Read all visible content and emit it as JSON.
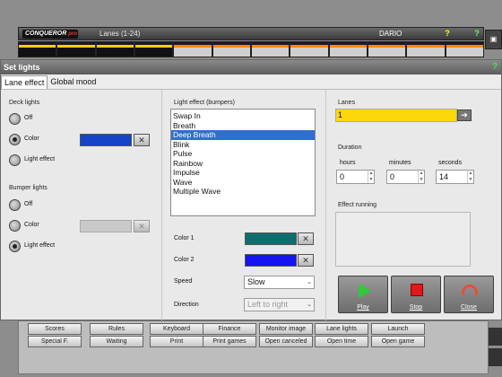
{
  "app": {
    "logo": "CONQUEROR",
    "logo_suffix": "pro",
    "lanes_label": "Lanes (1-24)",
    "user": "DARIO",
    "help_icon": "question-icon",
    "check_icon": "question-check-icon"
  },
  "background_buttons": {
    "row1": [
      "Scores",
      "Rules",
      "Keyboard",
      "Finance",
      "Monitor image",
      "Lane lights",
      "Launch"
    ],
    "row2": [
      "Special F.",
      "Waiting",
      "Print",
      "Print games",
      "Open canceled",
      "Open time",
      "Open game"
    ]
  },
  "dialog": {
    "title": "Set lights",
    "tabs": [
      "Lane effect",
      "Global mood"
    ],
    "selected_tab": 0,
    "deck_lights": {
      "label": "Deck lights",
      "options": [
        "Off",
        "Color",
        "Light effect"
      ],
      "selected": 1,
      "color": "#1444c8"
    },
    "bumper_lights": {
      "label": "Bumper lights",
      "options": [
        "Off",
        "Color",
        "Light effect"
      ],
      "selected": 2,
      "color": "#c9c9c9"
    },
    "light_effect": {
      "label": "Light effect (bumpers)",
      "items": [
        "Swap In",
        "Breath",
        "Deep Breath",
        "Blink",
        "Pulse",
        "Rainbow",
        "Impulse",
        "Wave",
        "Multiple Wave"
      ],
      "selected_index": 2
    },
    "color1": {
      "label": "Color 1",
      "value": "#0e6e6e"
    },
    "color2": {
      "label": "Color 2",
      "value": "#1414f0"
    },
    "speed": {
      "label": "Speed",
      "value": "Slow"
    },
    "direction": {
      "label": "Direction",
      "value": "Left to right"
    },
    "lanes": {
      "label": "Lanes",
      "value": "1"
    },
    "duration": {
      "label": "Duration",
      "hours_label": "hours",
      "minutes_label": "minutes",
      "seconds_label": "seconds",
      "hours": "0",
      "minutes": "0",
      "seconds": "14"
    },
    "effect_running": {
      "label": "Effect running"
    },
    "actions": {
      "play": "Play",
      "stop": "Stop",
      "close": "Close"
    }
  }
}
